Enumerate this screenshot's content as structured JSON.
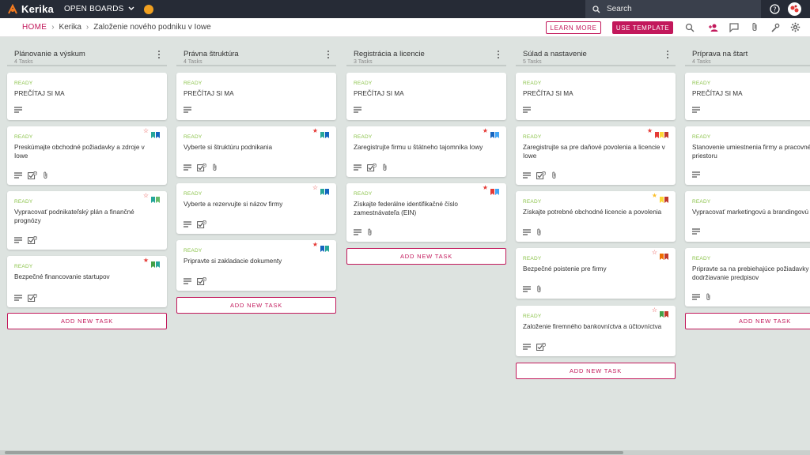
{
  "app": {
    "name": "Kerika",
    "open_boards": "OPEN BOARDS"
  },
  "search": {
    "label": "Search"
  },
  "breadcrumb": {
    "home": "HOME",
    "org": "Kerika",
    "board": "Založenie nového podniku v Iowe"
  },
  "actions": {
    "learn_more": "LEARN MORE",
    "use_template": "USE TEMPLATE"
  },
  "columns": [
    {
      "title": "Plánovanie a výskum",
      "count": "4 Tasks",
      "cards": [
        {
          "status": "READY",
          "title": "PREČÍTAJ SI MA",
          "star": "",
          "flags": [],
          "checklist": false,
          "attachment": false
        },
        {
          "status": "READY",
          "title": "Preskúmajte obchodné požiadavky a zdroje v Iowe",
          "star": "outline",
          "flags": [
            "#26a69a",
            "#1565c0"
          ],
          "checklist": true,
          "checklist_count": "0",
          "attachment": true
        },
        {
          "status": "READY",
          "title": "Vypracovať podnikateľský plán a finančné prognózy",
          "star": "outline",
          "flags": [
            "#26a69a",
            "#66bb6a"
          ],
          "checklist": true,
          "checklist_count": "0",
          "attachment": false
        },
        {
          "status": "READY",
          "title": "Bezpečné financovanie startupov",
          "star": "filled",
          "flags": [
            "#43a047",
            "#26a69a"
          ],
          "checklist": true,
          "checklist_count": "0",
          "attachment": false
        }
      ],
      "add_task": "ADD NEW TASK"
    },
    {
      "title": "Právna štruktúra",
      "count": "4 Tasks",
      "cards": [
        {
          "status": "READY",
          "title": "PREČÍTAJ SI MA",
          "star": "",
          "flags": [],
          "checklist": false,
          "attachment": false
        },
        {
          "status": "READY",
          "title": "Vyberte si štruktúru podnikania",
          "star": "filled",
          "flags": [
            "#26a69a",
            "#1565c0"
          ],
          "checklist": true,
          "checklist_count": "0",
          "attachment": true
        },
        {
          "status": "READY",
          "title": "Vyberte a rezervujte si názov firmy",
          "star": "outline",
          "flags": [
            "#26a69a",
            "#1565c0"
          ],
          "checklist": true,
          "checklist_count": "0",
          "attachment": false
        },
        {
          "status": "READY",
          "title": "Pripravte si zakladacie dokumenty",
          "star": "filled",
          "flags": [
            "#1565c0",
            "#26a69a"
          ],
          "checklist": true,
          "checklist_count": "0",
          "attachment": false
        }
      ],
      "add_task": "ADD NEW TASK"
    },
    {
      "title": "Registrácia a licencie",
      "count": "3 Tasks",
      "cards": [
        {
          "status": "READY",
          "title": "PREČÍTAJ SI MA",
          "star": "",
          "flags": [],
          "checklist": false,
          "attachment": false
        },
        {
          "status": "READY",
          "title": "Zaregistrujte firmu u štátneho tajomníka Iowy",
          "star": "filled",
          "flags": [
            "#1565c0",
            "#42a5f5"
          ],
          "checklist": true,
          "checklist_count": "0",
          "attachment": true
        },
        {
          "status": "READY",
          "title": "Získajte federálne identifikačné číslo zamestnávateľa (EIN)",
          "star": "filled",
          "flags": [
            "#e53935",
            "#42a5f5"
          ],
          "checklist": false,
          "attachment": true
        }
      ],
      "add_task": "ADD NEW TASK"
    },
    {
      "title": "Súlad a nastavenie",
      "count": "5 Tasks",
      "cards": [
        {
          "status": "READY",
          "title": "PREČÍTAJ SI MA",
          "star": "",
          "flags": [],
          "checklist": false,
          "attachment": false
        },
        {
          "status": "READY",
          "title": "Zaregistrujte sa pre daňové povolenia a licencie v Iowe",
          "star": "filled",
          "flags": [
            "#e53935",
            "#fdd835",
            "#c0392b"
          ],
          "checklist": true,
          "checklist_count": "0",
          "attachment": true
        },
        {
          "status": "READY",
          "title": "Získajte potrebné obchodné licencie a povolenia",
          "star": "filled-yellow",
          "flags": [
            "#fdd835",
            "#c0392b"
          ],
          "checklist": false,
          "attachment": true
        },
        {
          "status": "READY",
          "title": "Bezpečné poistenie pre firmy",
          "star": "outline",
          "flags": [
            "#ef6c00",
            "#c0392b"
          ],
          "checklist": false,
          "attachment": true
        },
        {
          "status": "READY",
          "title": "Založenie firemného bankovníctva a účtovníctva",
          "star": "outline",
          "flags": [
            "#43a047",
            "#c0392b"
          ],
          "checklist": true,
          "checklist_count": "0",
          "attachment": false
        }
      ],
      "add_task": "ADD NEW TASK"
    },
    {
      "title": "Príprava na štart",
      "count": "4 Tasks",
      "cards": [
        {
          "status": "READY",
          "title": "PREČÍTAJ SI MA",
          "star": "",
          "flags": [],
          "checklist": false,
          "attachment": false
        },
        {
          "status": "READY",
          "title": "Stanovenie umiestnenia firmy a pracovné priestoru",
          "star": "",
          "flags": [],
          "checklist": false,
          "attachment": false
        },
        {
          "status": "READY",
          "title": "Vypracovať marketingovú a brandingovú",
          "star": "",
          "flags": [],
          "checklist": false,
          "attachment": false
        },
        {
          "status": "READY",
          "title": "Pripravte sa na prebiehajúce požiadavky a dodržiavanie predpisov",
          "star": "",
          "flags": [],
          "checklist": false,
          "attachment": true
        }
      ],
      "add_task": "ADD NEW TASK"
    }
  ],
  "colors": {
    "brand": "#c2185b",
    "topbar": "#262b36",
    "ready": "#8bc34a",
    "board_bg": "#dde3e0"
  }
}
